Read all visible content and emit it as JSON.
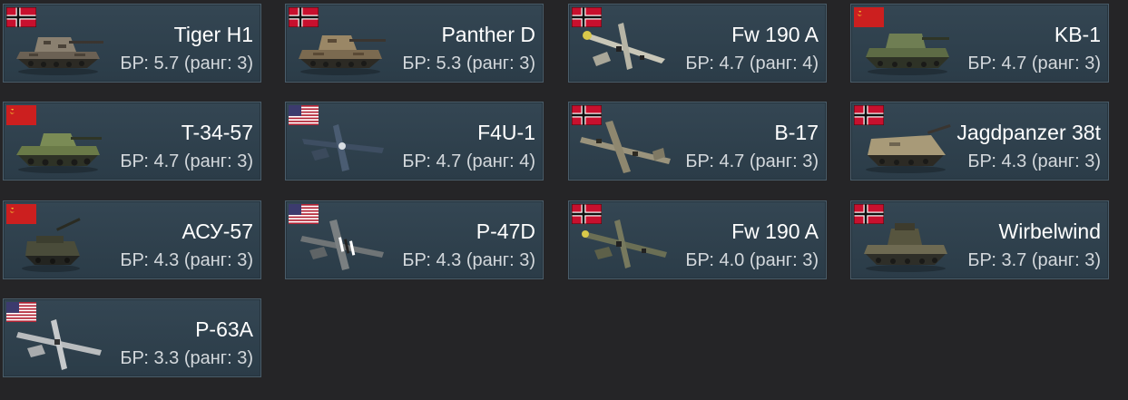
{
  "vehicles": [
    {
      "name": "Tiger H1",
      "br": "БР: 5.7 (ранг: 3)",
      "nation": "germany-flag",
      "kind": "tank"
    },
    {
      "name": "Panther D",
      "br": "БР: 5.3 (ранг: 3)",
      "nation": "germany-flag",
      "kind": "tank"
    },
    {
      "name": "Fw 190 A",
      "br": "БР: 4.7 (ранг: 4)",
      "nation": "germany-flag",
      "kind": "fighter-plane"
    },
    {
      "name": "KB-1",
      "br": "БР: 4.7 (ранг: 3)",
      "nation": "ussr-flag",
      "kind": "tank"
    },
    {
      "name": "T-34-57",
      "br": "БР: 4.7 (ранг: 3)",
      "nation": "ussr-flag",
      "kind": "tank"
    },
    {
      "name": "F4U-1",
      "br": "БР: 4.7 (ранг: 4)",
      "nation": "usa-flag",
      "kind": "fighter-plane"
    },
    {
      "name": "B-17",
      "br": "БР: 4.7 (ранг: 3)",
      "nation": "germany-flag",
      "kind": "bomber-plane"
    },
    {
      "name": "Jagdpanzer 38t",
      "br": "БР: 4.3 (ранг: 3)",
      "nation": "germany-flag",
      "kind": "tank"
    },
    {
      "name": "АСУ-57",
      "br": "БР: 4.3 (ранг: 3)",
      "nation": "ussr-flag",
      "kind": "tank"
    },
    {
      "name": "P-47D",
      "br": "БР: 4.3 (ранг: 3)",
      "nation": "usa-flag",
      "kind": "fighter-plane"
    },
    {
      "name": "Fw 190 A",
      "br": "БР: 4.0 (ранг: 3)",
      "nation": "germany-flag",
      "kind": "fighter-plane"
    },
    {
      "name": "Wirbelwind",
      "br": "БР: 3.7 (ранг: 3)",
      "nation": "germany-flag",
      "kind": "tank"
    },
    {
      "name": "P-63A",
      "br": "БР: 3.3 (ранг: 3)",
      "nation": "usa-flag",
      "kind": "fighter-plane"
    }
  ],
  "colors": {
    "card_background": "#2f414e",
    "card_border": "#4a5d6a",
    "page_background": "#252527",
    "name_text": "#ffffff",
    "br_text": "#d3d8dc"
  }
}
